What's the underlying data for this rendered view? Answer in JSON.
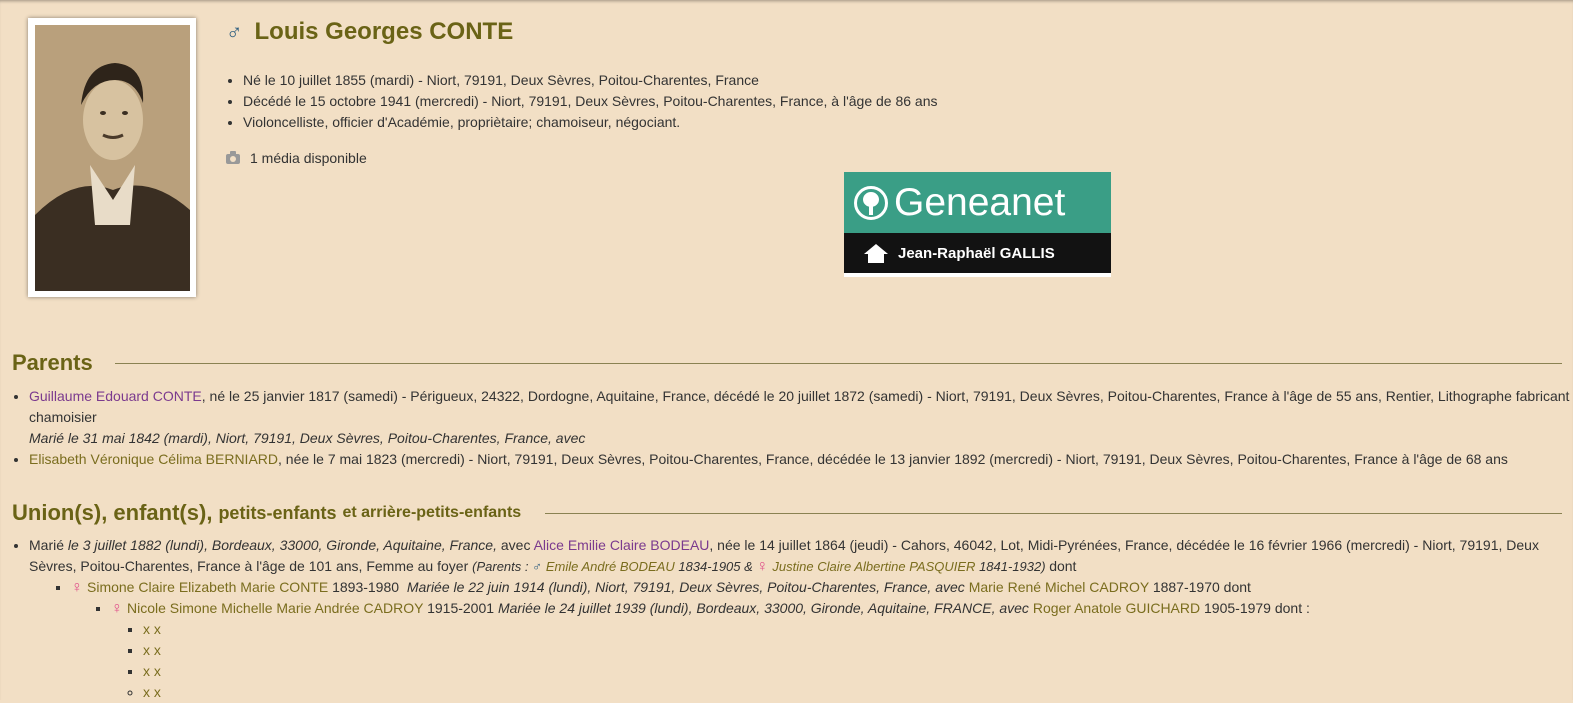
{
  "person": {
    "sex_symbol": "♂",
    "name": "Louis Georges CONTE",
    "facts": [
      "Né le 10 juillet 1855 (mardi) - Niort, 79191, Deux Sèvres, Poitou-Charentes, France",
      "Décédé le 15 octobre 1941 (mercredi) - Niort, 79191, Deux Sèvres, Poitou-Charentes, France, à l'âge de 86 ans",
      "Violoncelliste, officier d'Académie, propriètaire; chamoiseur, négociant."
    ],
    "media_label": "1 média disponible"
  },
  "banner": {
    "brand": "Geneanet",
    "owner": "Jean-Raphaël GALLIS"
  },
  "parents_section": {
    "heading": "Parents",
    "father": {
      "name": "Guillaume Edouard CONTE",
      "details": ", né le 25 janvier 1817 (samedi) - Périgueux, 24322, Dordogne, Aquitaine, France, décédé le 20 juillet 1872 (samedi) - Niort, 79191, Deux Sèvres, Poitou-Charentes, France à l'âge de 55 ans, Rentier, Lithographe fabricant chamoisier",
      "marriage": "Marié le 31 mai 1842 (mardi), Niort, 79191, Deux Sèvres, Poitou-Charentes, France, avec"
    },
    "mother": {
      "name": "Elisabeth Véronique Célima BERNIARD",
      "details": ", née le 7 mai 1823 (mercredi) - Niort, 79191, Deux Sèvres, Poitou-Charentes, France, décédée le 13 janvier 1892 (mercredi) - Niort, 79191, Deux Sèvres, Poitou-Charentes, France à l'âge de 68 ans"
    }
  },
  "unions_section": {
    "heading_main": "Union(s), enfant(s),",
    "heading_mid": "petits-enfants",
    "heading_small": "et arrière-petits-enfants",
    "union": {
      "prefix": "Marié",
      "marriage": "le 3 juillet 1882 (lundi), Bordeaux, 33000, Gironde, Aquitaine, France,",
      "avec": "avec",
      "spouse": "Alice Emilie Claire BODEAU",
      "spouse_details": ", née le 14 juillet 1864 (jeudi) - Cahors, 46042, Lot, Midi-Pyrénées, France, décédée le 16 février 1966 (mercredi) - Niort, 79191, Deux Sèvres, Poitou-Charentes, France à l'âge de 101 ans, Femme au foyer",
      "parents_open": "(Parents :",
      "spouse_father": "Emile André BODEAU",
      "spouse_father_years": "1834-1905 &",
      "spouse_mother": "Justine Claire Albertine PASQUIER",
      "spouse_mother_years": "1841-1932)",
      "dont": "dont"
    },
    "child": {
      "name": "Simone Claire Elizabeth Marie CONTE",
      "years": "1893-1980",
      "marriage": "Mariée le 22 juin 1914 (lundi), Niort, 79191, Deux Sèvres, Poitou-Charentes, France, avec",
      "spouse": "Marie René Michel CADROY",
      "spouse_years": "1887-1970 dont"
    },
    "grandchild": {
      "name": "Nicole Simone Michelle Marie Andrée CADROY",
      "years": "1915-2001",
      "marriage": "Mariée le 24 juillet 1939 (lundi), Bordeaux, 33000, Gironde, Aquitaine, FRANCE, avec",
      "spouse": "Roger Anatole GUICHARD",
      "spouse_years": "1905-1979 dont :"
    },
    "great_grandchildren": [
      "x x",
      "x x",
      "x x",
      "x x"
    ]
  },
  "colors": {
    "background": "#f2dfc5",
    "heading": "#6a6316",
    "link": "#7a6d1e",
    "link_purple": "#7b3a8e",
    "female": "#e0508a",
    "male": "#2b5c7e",
    "banner_green": "#3a9e86"
  },
  "icons": [
    "male-symbol-icon",
    "female-symbol-icon",
    "camera-icon",
    "geneanet-tree-icon",
    "home-icon"
  ]
}
